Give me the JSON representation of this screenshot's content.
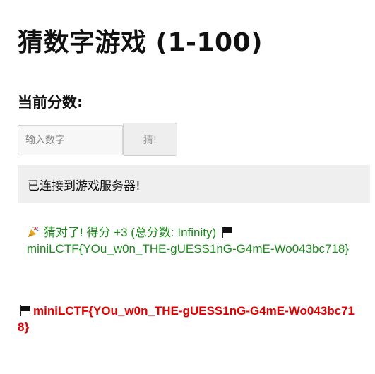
{
  "header": {
    "title": "猜数字游戏 (1-100)"
  },
  "score": {
    "label": "当前分数:"
  },
  "guess": {
    "placeholder": "输入数字",
    "button_label": "猜!"
  },
  "status": {
    "message": "已连接到游戏服务器!"
  },
  "result": {
    "icon": "party-popper-icon",
    "text": "猜对了! 得分 +3 (总分数: Infinity)",
    "flag_icon": "flag-icon",
    "flag": "miniLCTF{YOu_w0n_THE-gUESS1nG-G4mE-Wo043bc718}",
    "color": "#1c8a1c"
  },
  "flag_banner": {
    "icon": "flag-icon",
    "text": "miniLCTF{YOu_w0n_THE-gUESS1nG-G4mE-Wo043bc718}",
    "color": "#e00000"
  }
}
